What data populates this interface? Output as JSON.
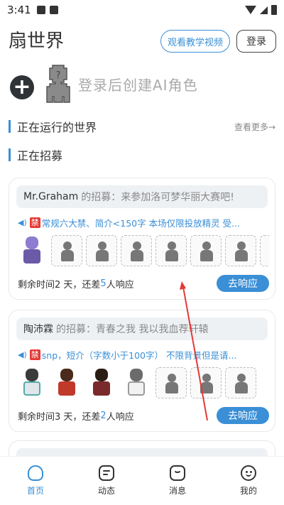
{
  "status_bar": {
    "time": "3:41"
  },
  "header": {
    "title": "扇世界",
    "tutorial_label": "观看教学视频",
    "login_label": "登录"
  },
  "create": {
    "text": "登录后创建AI角色"
  },
  "sections": {
    "running": {
      "title": "正在运行的世界",
      "see_more": "查看更多→"
    },
    "recruiting": {
      "title": "正在招募"
    }
  },
  "recruit_cards": [
    {
      "name": "Mr.Graham",
      "head_rest": "的招募：来参加洛可梦华丽大赛吧!",
      "ban_badge": "禁",
      "desc": "常规六大禁、简介<150字 本场仅限投放精灵 受...",
      "foot_prefix": "剩余时间2 天，还差",
      "need_count": "5",
      "foot_suffix": "人响应",
      "respond_label": "去响应"
    },
    {
      "name": "陶沛霖",
      "head_rest": "的招募：青春之我 我以我血荐轩辕",
      "ban_badge": "禁",
      "desc": "snp，短介（字数小于100字） 不限背景但是请...",
      "foot_prefix": "剩余时间3 天，还差",
      "need_count": "2",
      "foot_suffix": "人响应",
      "respond_label": "去响应"
    }
  ],
  "tabbar": {
    "items": [
      {
        "label": "首页",
        "icon": "home-icon"
      },
      {
        "label": "动态",
        "icon": "chat-icon"
      },
      {
        "label": "消息",
        "icon": "mail-icon"
      },
      {
        "label": "我的",
        "icon": "profile-icon"
      }
    ]
  },
  "colors": {
    "accent": "#3a8fd6",
    "ban": "#e53935",
    "arrow": "#e53935"
  }
}
